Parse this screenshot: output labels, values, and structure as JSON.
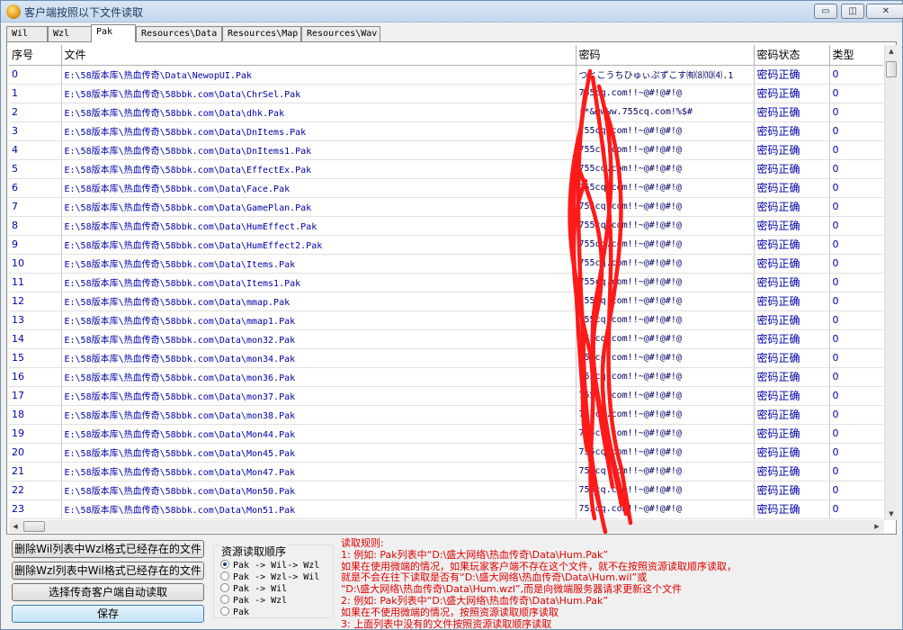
{
  "window": {
    "title": "客户端按照以下文件读取",
    "minimize": "▭",
    "maximize": "◫",
    "close": "✕"
  },
  "tabs": [
    "Wil",
    "Wzl",
    "Pak",
    "Resources\\Data",
    "Resources\\Map",
    "Resources\\Wav"
  ],
  "active_tab": "Pak",
  "table": {
    "columns": [
      "序号",
      "文件",
      "密码",
      "密码状态",
      "类型"
    ],
    "rows": [
      {
        "idx": "0",
        "file": "E:\\58版本库\\热血传奇\\Data\\NewopUI.Pak",
        "pwd": "つとこうちひゅぃぷずこす㈲⑻⑽⑷.1",
        "status": "密码正确",
        "type": "0"
      },
      {
        "idx": "1",
        "file": "E:\\58版本库\\热血传奇\\58bbk.com\\Data\\ChrSel.Pak",
        "pwd": "755cq.com!!~@#!@#!@",
        "status": "密码正确",
        "type": "0"
      },
      {
        "idx": "2",
        "file": "E:\\58版本库\\热血传奇\\58bbk.com\\Data\\dhk.Pak",
        "pwd": "(*&@www.755cq.com!%$#",
        "status": "密码正确",
        "type": "0"
      },
      {
        "idx": "3",
        "file": "E:\\58版本库\\热血传奇\\58bbk.com\\Data\\DnItems.Pak",
        "pwd": "755cq.com!!~@#!@#!@",
        "status": "密码正确",
        "type": "0"
      },
      {
        "idx": "4",
        "file": "E:\\58版本库\\热血传奇\\58bbk.com\\Data\\DnItems1.Pak",
        "pwd": "755cq.com!!~@#!@#!@",
        "status": "密码正确",
        "type": "0"
      },
      {
        "idx": "5",
        "file": "E:\\58版本库\\热血传奇\\58bbk.com\\Data\\EffectEx.Pak",
        "pwd": "755cq.com!!~@#!@#!@",
        "status": "密码正确",
        "type": "0"
      },
      {
        "idx": "6",
        "file": "E:\\58版本库\\热血传奇\\58bbk.com\\Data\\Face.Pak",
        "pwd": "755cq.com!!~@#!@#!@",
        "status": "密码正确",
        "type": "0"
      },
      {
        "idx": "7",
        "file": "E:\\58版本库\\热血传奇\\58bbk.com\\Data\\GamePlan.Pak",
        "pwd": "755cq.com!!~@#!@#!@",
        "status": "密码正确",
        "type": "0"
      },
      {
        "idx": "8",
        "file": "E:\\58版本库\\热血传奇\\58bbk.com\\Data\\HumEffect.Pak",
        "pwd": "755cq.com!!~@#!@#!@",
        "status": "密码正确",
        "type": "0"
      },
      {
        "idx": "9",
        "file": "E:\\58版本库\\热血传奇\\58bbk.com\\Data\\HumEffect2.Pak",
        "pwd": "755cq.com!!~@#!@#!@",
        "status": "密码正确",
        "type": "0"
      },
      {
        "idx": "10",
        "file": "E:\\58版本库\\热血传奇\\58bbk.com\\Data\\Items.Pak",
        "pwd": "755cq.com!!~@#!@#!@",
        "status": "密码正确",
        "type": "0"
      },
      {
        "idx": "11",
        "file": "E:\\58版本库\\热血传奇\\58bbk.com\\Data\\Items1.Pak",
        "pwd": "755cq.com!!~@#!@#!@",
        "status": "密码正确",
        "type": "0"
      },
      {
        "idx": "12",
        "file": "E:\\58版本库\\热血传奇\\58bbk.com\\Data\\mmap.Pak",
        "pwd": "755cq.com!!~@#!@#!@",
        "status": "密码正确",
        "type": "0"
      },
      {
        "idx": "13",
        "file": "E:\\58版本库\\热血传奇\\58bbk.com\\Data\\mmap1.Pak",
        "pwd": "755cq.com!!~@#!@#!@",
        "status": "密码正确",
        "type": "0"
      },
      {
        "idx": "14",
        "file": "E:\\58版本库\\热血传奇\\58bbk.com\\Data\\mon32.Pak",
        "pwd": "755cq.com!!~@#!@#!@",
        "status": "密码正确",
        "type": "0"
      },
      {
        "idx": "15",
        "file": "E:\\58版本库\\热血传奇\\58bbk.com\\Data\\mon34.Pak",
        "pwd": "755cq.com!!~@#!@#!@",
        "status": "密码正确",
        "type": "0"
      },
      {
        "idx": "16",
        "file": "E:\\58版本库\\热血传奇\\58bbk.com\\Data\\mon36.Pak",
        "pwd": "755cq.com!!~@#!@#!@",
        "status": "密码正确",
        "type": "0"
      },
      {
        "idx": "17",
        "file": "E:\\58版本库\\热血传奇\\58bbk.com\\Data\\mon37.Pak",
        "pwd": "755cq.com!!~@#!@#!@",
        "status": "密码正确",
        "type": "0"
      },
      {
        "idx": "18",
        "file": "E:\\58版本库\\热血传奇\\58bbk.com\\Data\\mon38.Pak",
        "pwd": "755cq.com!!~@#!@#!@",
        "status": "密码正确",
        "type": "0"
      },
      {
        "idx": "19",
        "file": "E:\\58版本库\\热血传奇\\58bbk.com\\Data\\Mon44.Pak",
        "pwd": "755cq.com!!~@#!@#!@",
        "status": "密码正确",
        "type": "0"
      },
      {
        "idx": "20",
        "file": "E:\\58版本库\\热血传奇\\58bbk.com\\Data\\Mon45.Pak",
        "pwd": "755cq.com!!~@#!@#!@",
        "status": "密码正确",
        "type": "0"
      },
      {
        "idx": "21",
        "file": "E:\\58版本库\\热血传奇\\58bbk.com\\Data\\Mon47.Pak",
        "pwd": "755cq.com!!~@#!@#!@",
        "status": "密码正确",
        "type": "0"
      },
      {
        "idx": "22",
        "file": "E:\\58版本库\\热血传奇\\58bbk.com\\Data\\Mon50.Pak",
        "pwd": "755cq.com!!~@#!@#!@",
        "status": "密码正确",
        "type": "0"
      },
      {
        "idx": "23",
        "file": "E:\\58版本库\\热血传奇\\58bbk.com\\Data\\Mon51.Pak",
        "pwd": "755cq.com!!~@#!@#!@",
        "status": "密码正确",
        "type": "0"
      }
    ]
  },
  "buttons": {
    "delete_wil": "删除Wil列表中Wzl格式已经存在的文件",
    "delete_wzl": "删除Wzl列表中Wil格式已经存在的文件",
    "auto_read": "选择传奇客户端自动读取",
    "save": "保存"
  },
  "read_order": {
    "title": "资源读取顺序",
    "options": [
      "Pak -> Wil-> Wzl",
      "Pak -> Wzl-> Wil",
      "Pak -> Wil",
      "Pak -> Wzl",
      "Pak"
    ],
    "selected": 0
  },
  "rules": [
    "读取规则:",
    "1: 例如: Pak列表中“D:\\盛大网络\\热血传奇\\Data\\Hum.Pak”",
    "    如果在使用微端的情况，如果玩家客户端不存在这个文件，就不在按照资源读取顺序读取，",
    "    就是不会在往下读取是否有“D:\\盛大网络\\热血传奇\\Data\\Hum.wil”或",
    "    “D:\\盛大网络\\热血传奇\\Data\\Hum.wzl”,而是向微端服务器请求更新这个文件",
    "2: 例如: Pak列表中“D:\\盛大网络\\热血传奇\\Data\\Hum.Pak”",
    "    如果在不使用微端的情况，按照资源读取顺序读取",
    "3: 上面列表中没有的文件按照资源读取顺序读取"
  ],
  "colors": {
    "rules_text": "#e00000",
    "cell_text": "#0000aa",
    "scribble": "#ff1a1a"
  }
}
